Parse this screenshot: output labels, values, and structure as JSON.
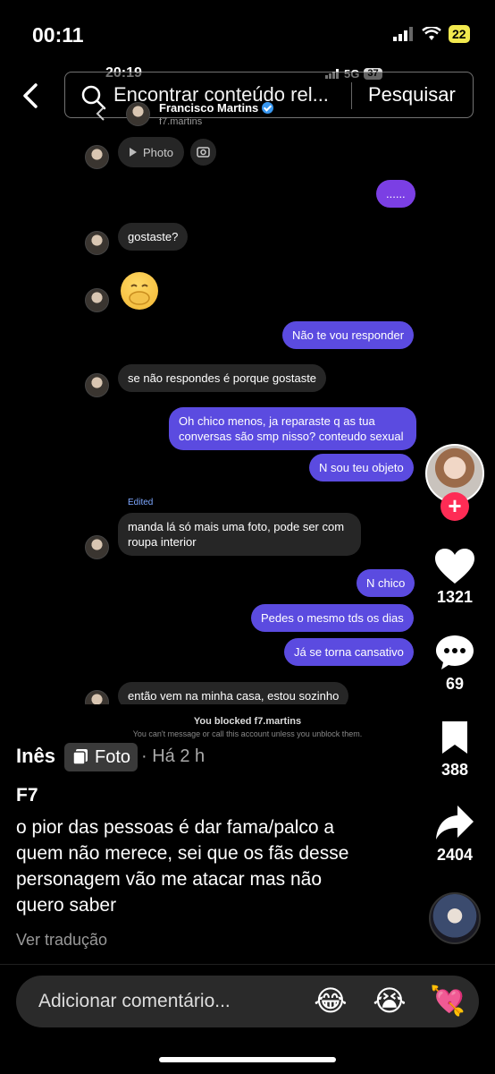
{
  "status_bar": {
    "time": "00:11",
    "battery": "22"
  },
  "search": {
    "placeholder": "Encontrar conteúdo rel...",
    "button": "Pesquisar"
  },
  "inner_screenshot": {
    "time": "20:19",
    "network": "5G",
    "battery": "37",
    "contact_name": "Francisco Martins",
    "contact_handle": "f7.martins",
    "photo_label": "Photo",
    "edited_label": "Edited",
    "messages": [
      {
        "side": "sent",
        "text": "......"
      },
      {
        "side": "received",
        "text": "gostaste?"
      },
      {
        "side": "sent",
        "text": "Não te vou responder"
      },
      {
        "side": "received",
        "text": "se não respondes é porque gostaste"
      },
      {
        "side": "sent",
        "text": "Oh chico menos, ja reparaste q as tua conversas são smp nisso? conteudo sexual"
      },
      {
        "side": "sent",
        "text": "N sou teu objeto"
      },
      {
        "side": "received",
        "text": "manda lá só mais uma foto, pode ser com roupa interior"
      },
      {
        "side": "sent",
        "text": "N chico"
      },
      {
        "side": "sent",
        "text": "Pedes o mesmo tds os dias"
      },
      {
        "side": "sent",
        "text": "Já se torna cansativo"
      },
      {
        "side": "received",
        "text": "então vem na minha casa, estou sozinho"
      }
    ],
    "blocked_title": "You blocked f7.martins",
    "blocked_subtitle": "You can't message or call this account unless you unblock them."
  },
  "rail": {
    "likes": "1321",
    "comments": "69",
    "saves": "388",
    "shares": "2404"
  },
  "post": {
    "author": "Inês",
    "type_badge": "Foto",
    "time_ago": "· Há 2 h",
    "title": "F7",
    "caption": "o pior das pessoas é dar fama/palco a quem não merece, sei que os fãs desse personagem vão me atacar mas não quero saber",
    "translate": "Ver tradução"
  },
  "comment": {
    "placeholder": "Adicionar comentário...",
    "emojis": [
      "😂",
      "😭",
      "💘"
    ]
  }
}
